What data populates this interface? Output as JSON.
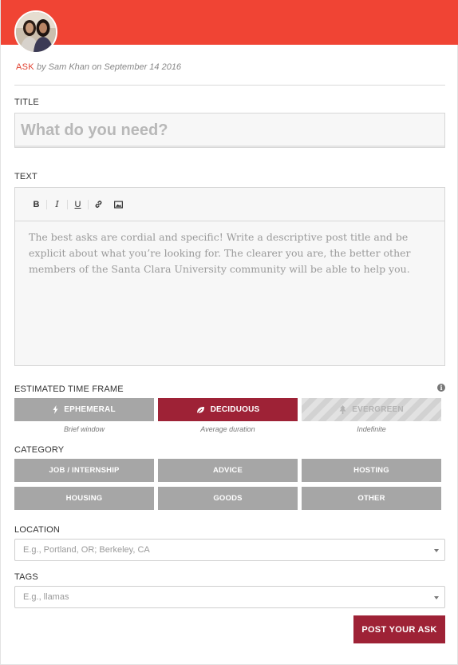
{
  "header": {
    "accent_color": "#f04434",
    "avatar_icon": "profile-photo-two-people"
  },
  "post_meta": {
    "type": "ASK",
    "by_text": "by",
    "author": "Sam Khan",
    "on_text": "on",
    "date": "September 14 2016"
  },
  "title_section": {
    "label": "TITLE",
    "placeholder": "What do you need?",
    "value": ""
  },
  "text_section": {
    "label": "TEXT",
    "toolbar": {
      "bold": "B",
      "italic": "I",
      "underline": "U",
      "link_icon": "link-icon",
      "image_icon": "image-icon"
    },
    "placeholder": "The best asks are cordial and specific! Write a descriptive post title and be explicit about what you’re looking for. The clearer you are, the better other members of the Santa Clara University community will be able to help you."
  },
  "time_frame": {
    "label": "ESTIMATED TIME FRAME",
    "info_icon": "i",
    "options": [
      {
        "label": "EPHEMERAL",
        "caption": "Brief window",
        "icon": "lightning-icon",
        "state": "default"
      },
      {
        "label": "DECIDUOUS",
        "caption": "Average duration",
        "icon": "leaf-icon",
        "state": "selected"
      },
      {
        "label": "EVERGREEN",
        "caption": "Indefinite",
        "icon": "tree-icon",
        "state": "disabled"
      }
    ],
    "colors": {
      "default": "#a6a6a6",
      "selected": "#9e2236"
    }
  },
  "category": {
    "label": "CATEGORY",
    "options": [
      "JOB / INTERNSHIP",
      "ADVICE",
      "HOSTING",
      "HOUSING",
      "GOODS",
      "OTHER"
    ]
  },
  "location": {
    "label": "LOCATION",
    "placeholder": "E.g., Portland, OR; Berkeley, CA"
  },
  "tags": {
    "label": "TAGS",
    "placeholder": "E.g., llamas"
  },
  "submit": {
    "label": "POST YOUR ASK",
    "color": "#9e2236"
  }
}
